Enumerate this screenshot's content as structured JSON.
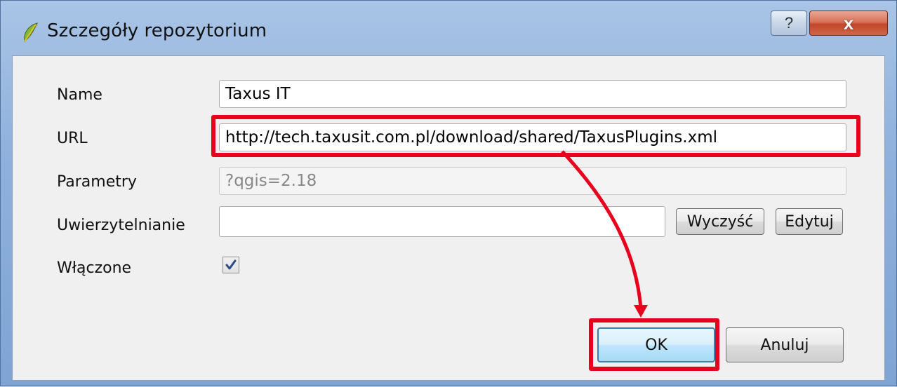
{
  "window": {
    "title": "Szczegóły repozytorium",
    "help_label": "?",
    "close_label": "x"
  },
  "form": {
    "name_label": "Name",
    "name_value": "Taxus IT",
    "url_label": "URL",
    "url_value": "http://tech.taxusit.com.pl/download/shared/TaxusPlugins.xml",
    "params_label": "Parametry",
    "params_value": "?qgis=2.18",
    "auth_label": "Uwierzytelnianie",
    "auth_value": "",
    "clear_label": "Wyczyść",
    "edit_label": "Edytuj",
    "enabled_label": "Włączone",
    "enabled_checked": true
  },
  "buttons": {
    "ok_label": "OK",
    "cancel_label": "Anuluj"
  },
  "colors": {
    "highlight": "#e8001c"
  }
}
